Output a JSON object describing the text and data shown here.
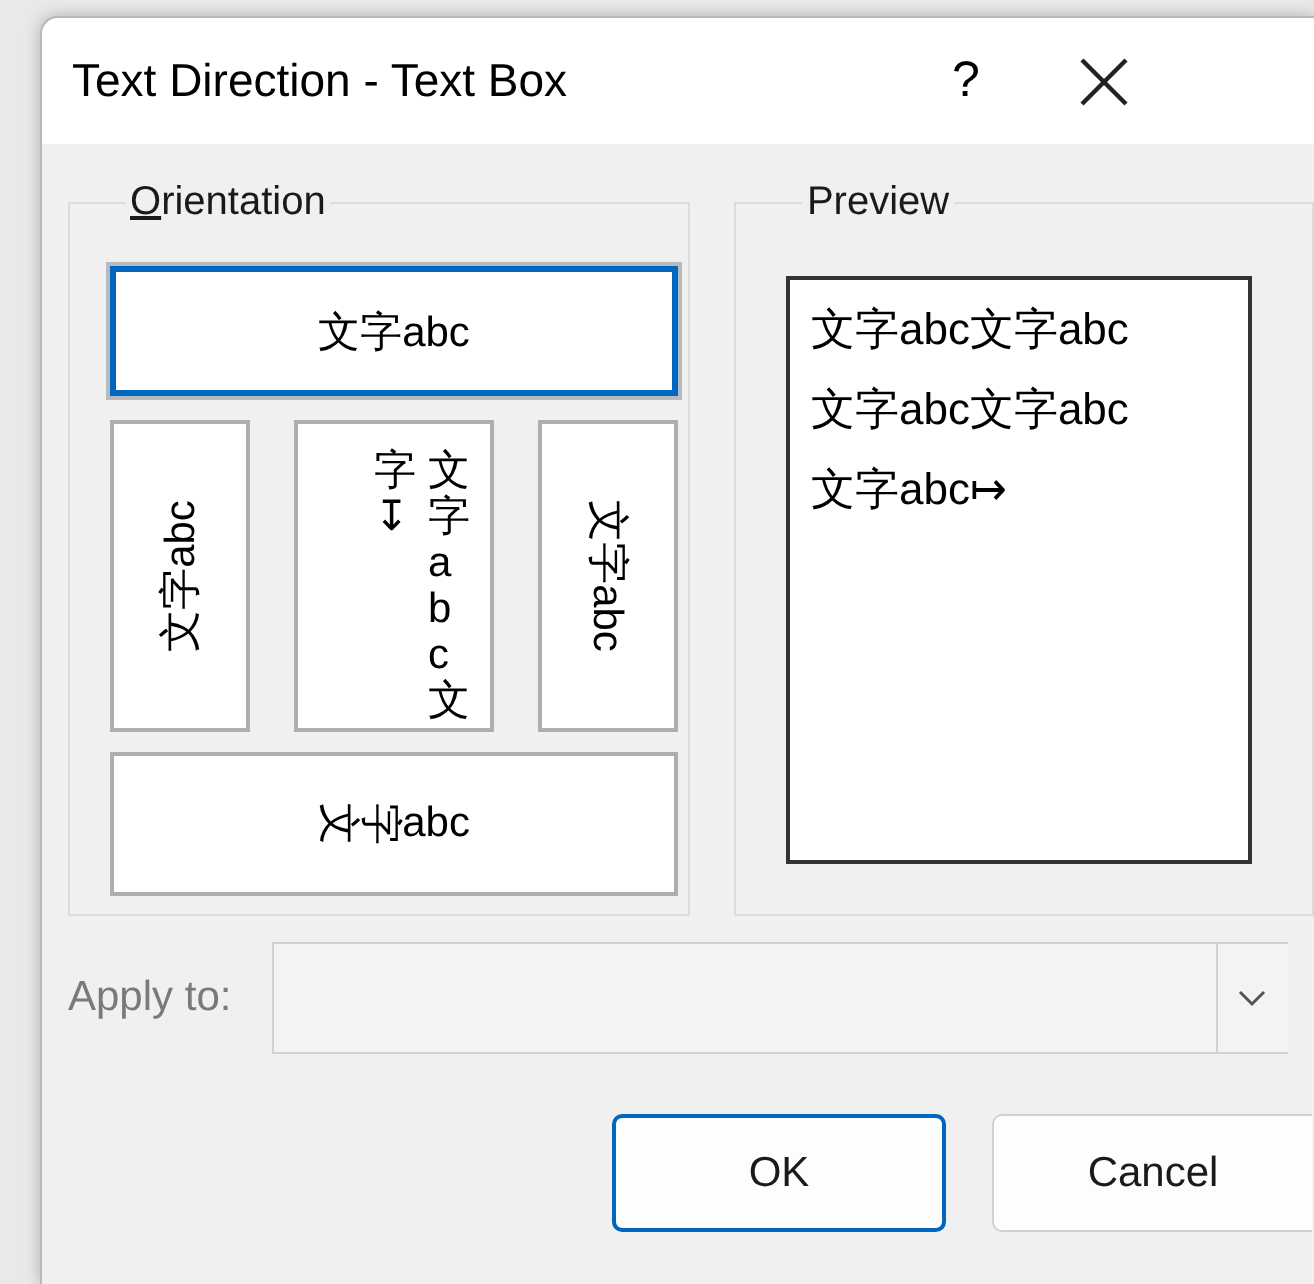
{
  "window": {
    "title": "Text Direction - Text Box",
    "help_button": "?"
  },
  "orientation": {
    "label": "Orientation",
    "access_key_underlined": true,
    "options": [
      {
        "kind": "horizontal",
        "text": "文字abc",
        "selected": true
      },
      {
        "kind": "rotate-up",
        "text": "文字abc",
        "selected": false
      },
      {
        "kind": "stacked",
        "columns": [
          "字↧",
          "文字abc文"
        ],
        "selected": false
      },
      {
        "kind": "rotate-down",
        "text": "文字abc",
        "selected": false
      },
      {
        "kind": "cjk-rotated",
        "parts": [
          {
            "text": "文字",
            "rotated": true
          },
          {
            "text": "abc",
            "rotated": false
          }
        ],
        "selected": false
      }
    ]
  },
  "preview": {
    "label": "Preview",
    "lines": [
      "文字abc文字abc",
      "文字abc文字abc",
      "文字abc↦"
    ]
  },
  "apply_to": {
    "label": "Apply to:",
    "disabled": true
  },
  "buttons": [
    {
      "label": "OK",
      "default": true
    },
    {
      "label": "Cancel",
      "default": false
    }
  ]
}
